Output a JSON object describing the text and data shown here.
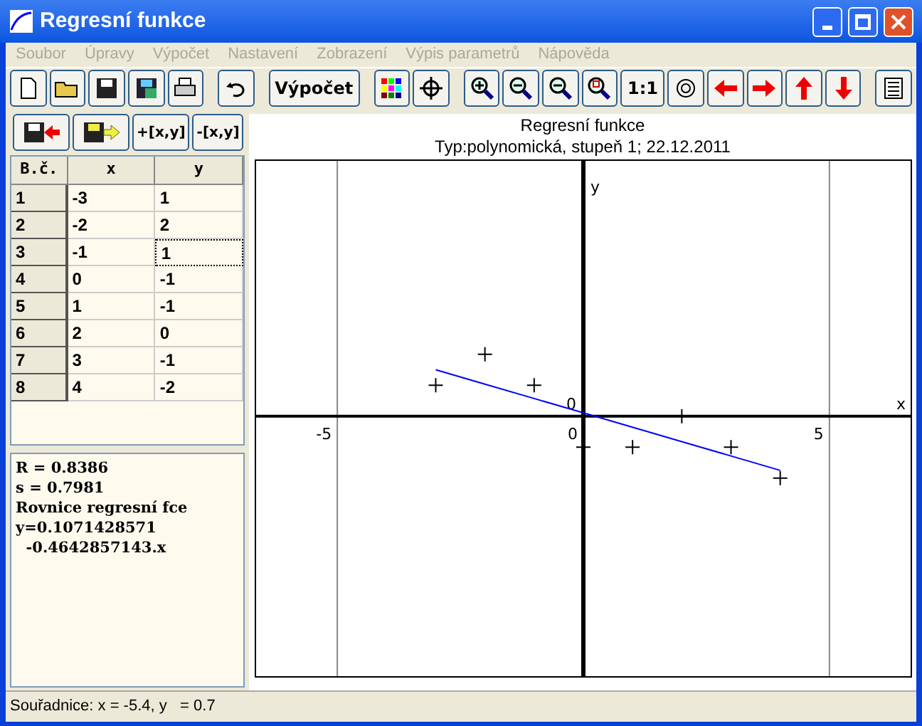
{
  "window": {
    "title": "Regresní funkce"
  },
  "menu": [
    {
      "label": "Soubor",
      "disabled": true
    },
    {
      "label": "Úpravy",
      "disabled": true
    },
    {
      "label": "Výpočet",
      "disabled": true
    },
    {
      "label": "Nastavení",
      "disabled": true
    },
    {
      "label": "Zobrazení",
      "disabled": true
    },
    {
      "label": "Výpis parametrů",
      "disabled": true
    },
    {
      "label": "Nápověda",
      "disabled": true
    }
  ],
  "toolbar": [
    {
      "kind": "new"
    },
    {
      "kind": "open"
    },
    {
      "kind": "save"
    },
    {
      "kind": "saveas"
    },
    {
      "kind": "print"
    },
    {
      "kind": "gap"
    },
    {
      "kind": "undo"
    },
    {
      "kind": "gap"
    },
    {
      "kind": "text",
      "label": "Výpočet"
    },
    {
      "kind": "gap"
    },
    {
      "kind": "colors"
    },
    {
      "kind": "crosshair"
    },
    {
      "kind": "gap"
    },
    {
      "kind": "zoomin"
    },
    {
      "kind": "zoomout"
    },
    {
      "kind": "zoomfit"
    },
    {
      "kind": "zoomwin"
    },
    {
      "kind": "text",
      "label": "1:1"
    },
    {
      "kind": "target"
    },
    {
      "kind": "left"
    },
    {
      "kind": "right"
    },
    {
      "kind": "up"
    },
    {
      "kind": "down"
    },
    {
      "kind": "gap"
    },
    {
      "kind": "list"
    }
  ],
  "table_toolbar": [
    {
      "kind": "import"
    },
    {
      "kind": "export"
    },
    {
      "kind": "text",
      "label": "+[x,y]"
    },
    {
      "kind": "text",
      "label": "-[x,y]"
    }
  ],
  "table": {
    "columns": [
      "B.č.",
      "x",
      "y"
    ],
    "rows": [
      {
        "cells": [
          "1",
          "-3",
          "1"
        ],
        "selected": false
      },
      {
        "cells": [
          "2",
          "-2",
          "2"
        ],
        "selected": false
      },
      {
        "cells": [
          "3",
          "-1",
          "1"
        ],
        "selected": true
      },
      {
        "cells": [
          "4",
          "0",
          "-1"
        ],
        "selected": false
      },
      {
        "cells": [
          "5",
          "1",
          "-1"
        ],
        "selected": false
      },
      {
        "cells": [
          "6",
          "2",
          "0"
        ],
        "selected": false
      },
      {
        "cells": [
          "7",
          "3",
          "-1"
        ],
        "selected": false
      },
      {
        "cells": [
          "8",
          "4",
          "-2"
        ],
        "selected": false
      }
    ]
  },
  "results": [
    "R = 0.8386",
    "s = 0.7981",
    "Rovnice regresní fce",
    "y=0.1071428571",
    "  -0.4642857143.x"
  ],
  "chart": {
    "title": "Regresní funkce",
    "subtitle": "Typ:polynomická, stupeň 1; 22.12.2011",
    "plot": {
      "x_axis_label": "x",
      "y_axis_label": "y",
      "x_tick_labels": [
        "-5",
        "0",
        "5"
      ],
      "origin_label": "0"
    }
  },
  "status_bar": "Souřadnice: x = -5.4, y   = 0.7"
}
